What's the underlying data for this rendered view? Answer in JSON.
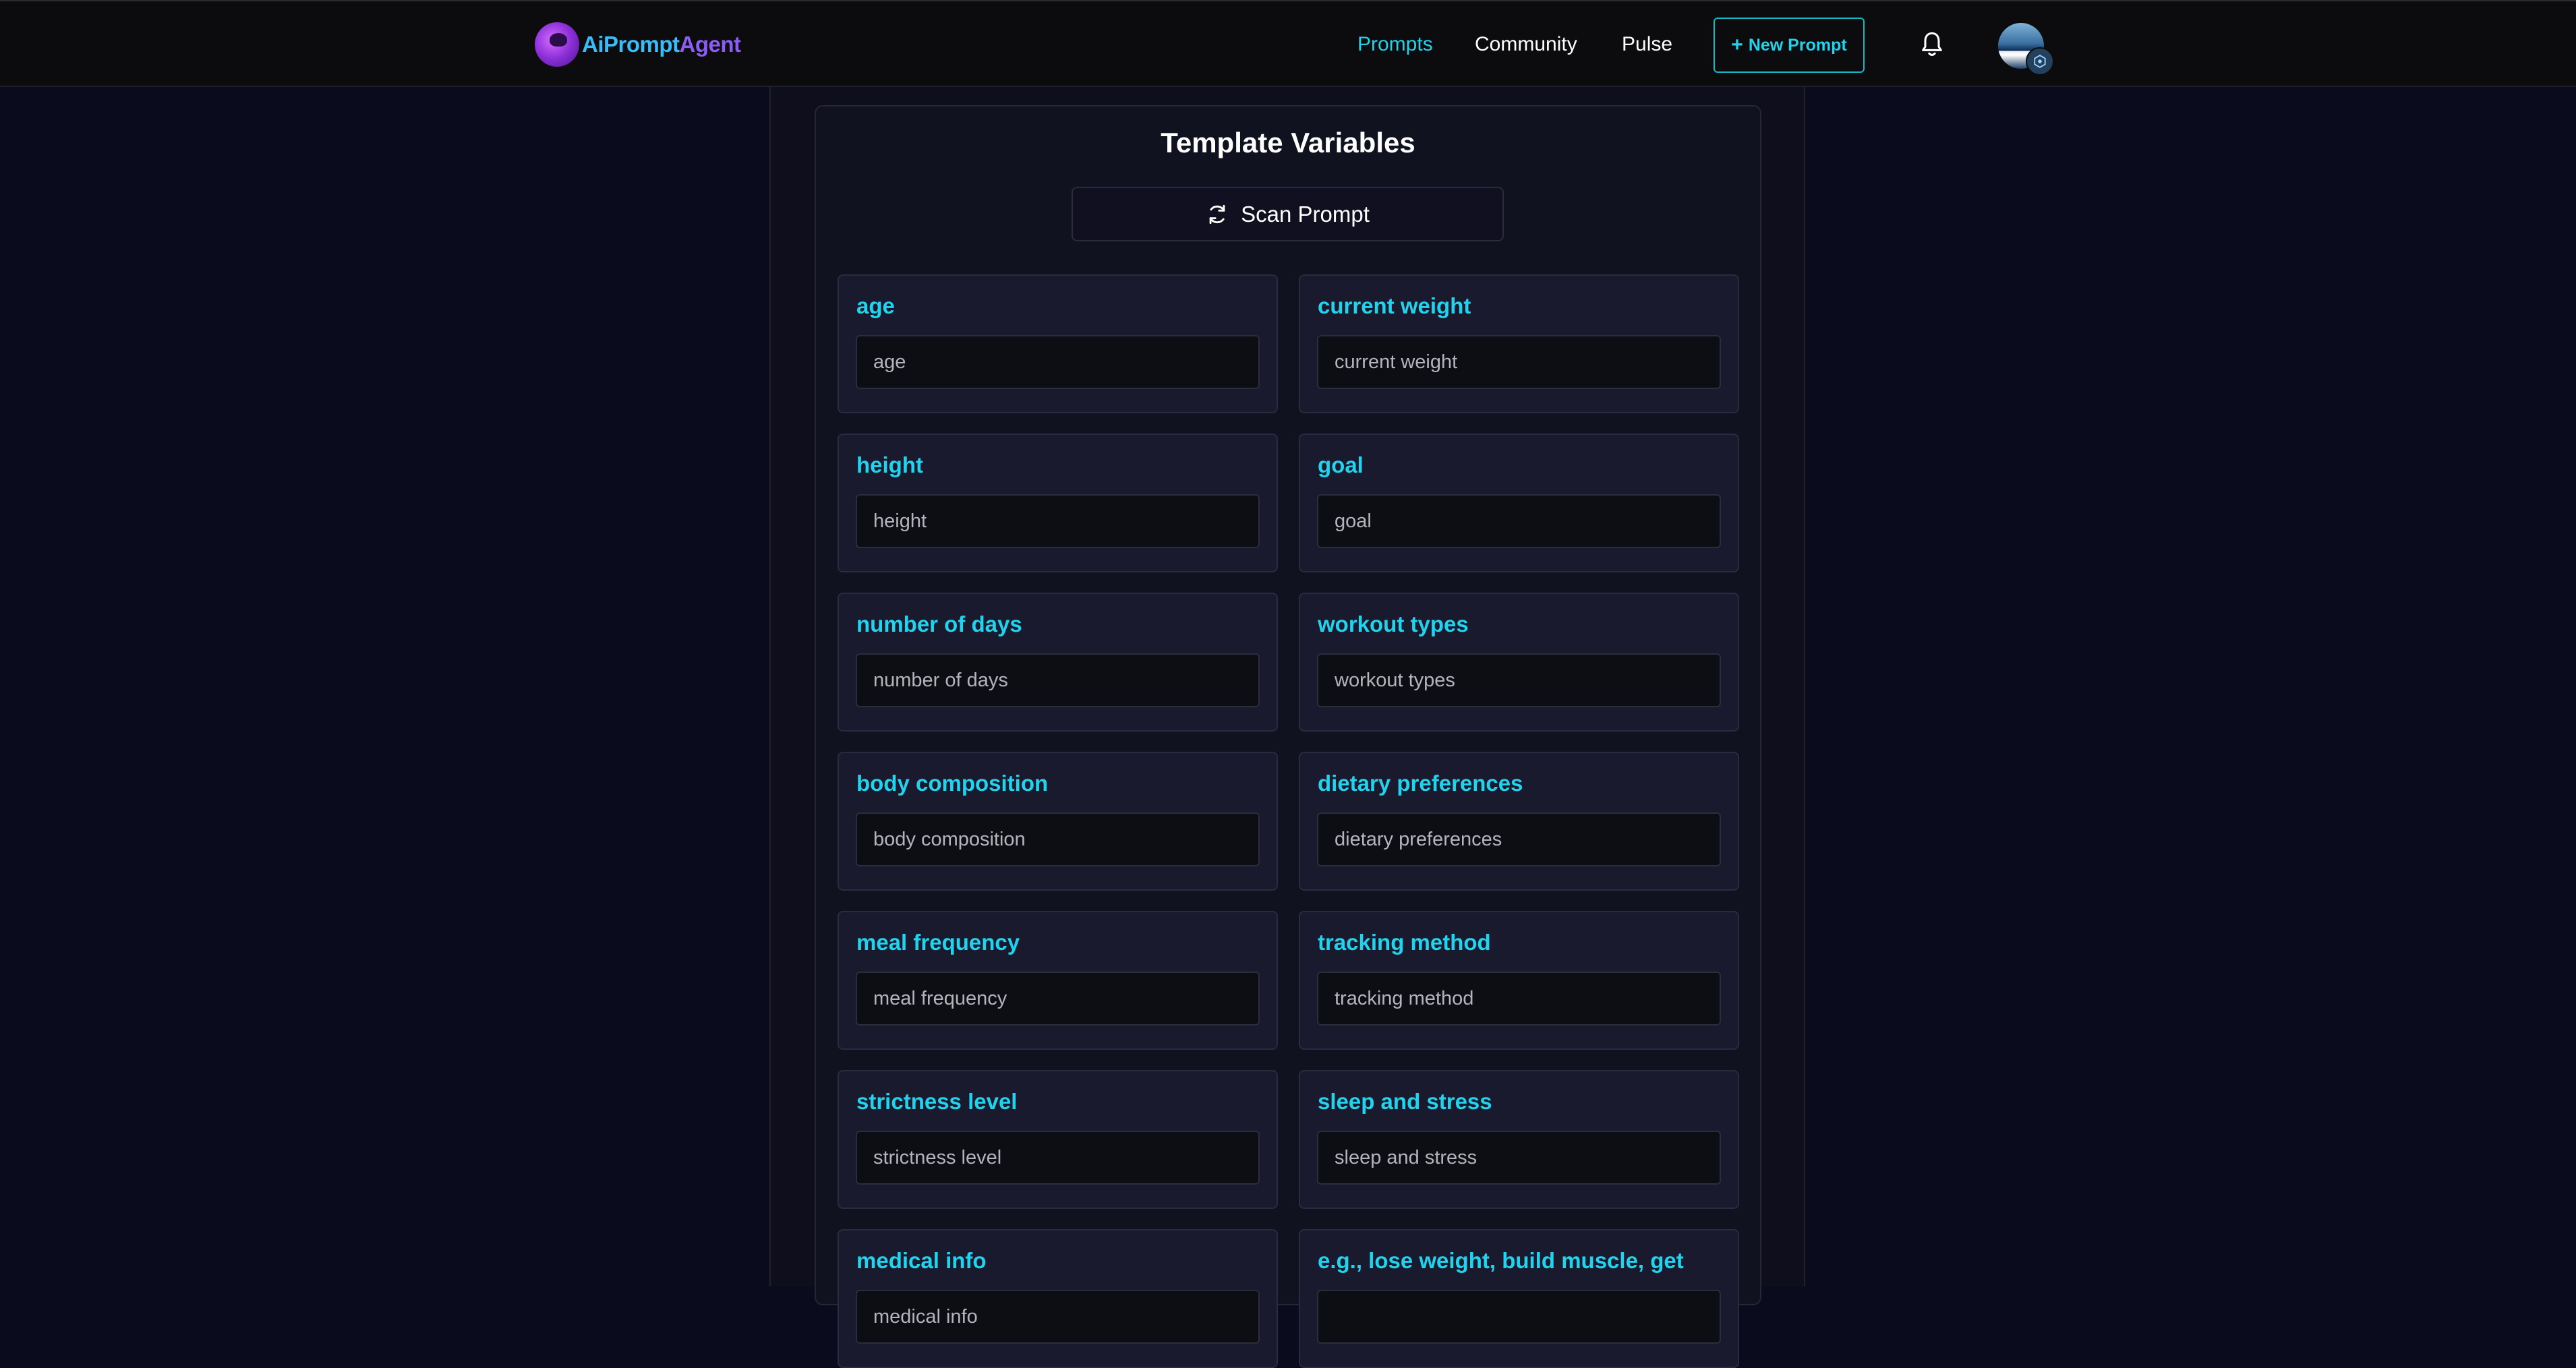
{
  "nav": {
    "logo_part1": "AiPrompt",
    "logo_part2": "Agent",
    "links": [
      "Prompts",
      "Community",
      "Pulse"
    ],
    "new_prompt_label": "New Prompt",
    "new_prompt_icon": "plus-icon",
    "active_link": "Prompts"
  },
  "panel": {
    "title": "Template Variables",
    "scan_label": "Scan Prompt",
    "scan_icon": "refresh-icon"
  },
  "variables": [
    {
      "label": "age",
      "placeholder": "age"
    },
    {
      "label": "current weight",
      "placeholder": "current weight"
    },
    {
      "label": "height",
      "placeholder": "height"
    },
    {
      "label": "goal",
      "placeholder": "goal"
    },
    {
      "label": "number of days",
      "placeholder": "number of days"
    },
    {
      "label": "workout types",
      "placeholder": "workout types"
    },
    {
      "label": "body composition",
      "placeholder": "body composition"
    },
    {
      "label": "dietary preferences",
      "placeholder": "dietary preferences"
    },
    {
      "label": "meal frequency",
      "placeholder": "meal frequency"
    },
    {
      "label": "tracking method",
      "placeholder": "tracking method"
    },
    {
      "label": "strictness level",
      "placeholder": "strictness level"
    },
    {
      "label": "sleep and stress",
      "placeholder": "sleep and stress"
    },
    {
      "label": "medical info",
      "placeholder": "medical info"
    },
    {
      "label": "e.g., lose weight, build muscle, get",
      "placeholder": ""
    }
  ],
  "colors": {
    "accent": "#22d3ee",
    "background": "#0b0b1e",
    "card": "#1a1a2e"
  }
}
